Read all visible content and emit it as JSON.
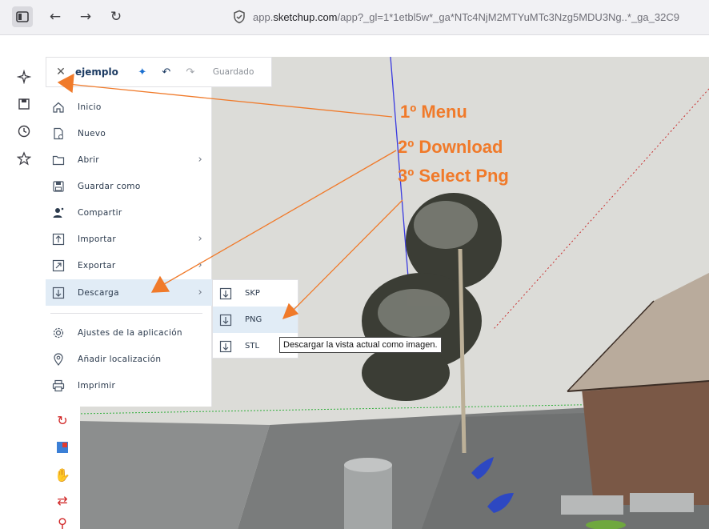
{
  "browser": {
    "url_prefix": "app.",
    "url_domain": "sketchup.com",
    "url_rest": "/app?_gl=1*1etbl5w*_ga*NTc4NjM2MTYuMTc3Nzg5MDU3Ng..*_ga_32C9"
  },
  "doc_bar": {
    "title": "ejemplo",
    "saved_label": "Guardado"
  },
  "menu": {
    "items": [
      {
        "label": "Inicio"
      },
      {
        "label": "Nuevo"
      },
      {
        "label": "Abrir"
      },
      {
        "label": "Guardar como"
      },
      {
        "label": "Compartir"
      },
      {
        "label": "Importar"
      },
      {
        "label": "Exportar"
      },
      {
        "label": "Descarga"
      },
      {
        "label": "Ajustes de la aplicación"
      },
      {
        "label": "Añadir localización"
      },
      {
        "label": "Imprimir"
      }
    ]
  },
  "download_submenu": {
    "items": [
      {
        "label": "SKP"
      },
      {
        "label": "PNG"
      },
      {
        "label": "STL"
      }
    ]
  },
  "tooltip": "Descargar la vista actual como imagen.",
  "annotations": {
    "step1": "1º Menu",
    "step2": "2º Download",
    "step3": "3º Select Png"
  },
  "colors": {
    "annotation": "#f07a2a",
    "menu_active": "#e1ecf6",
    "sky": "#dcdcd8"
  }
}
